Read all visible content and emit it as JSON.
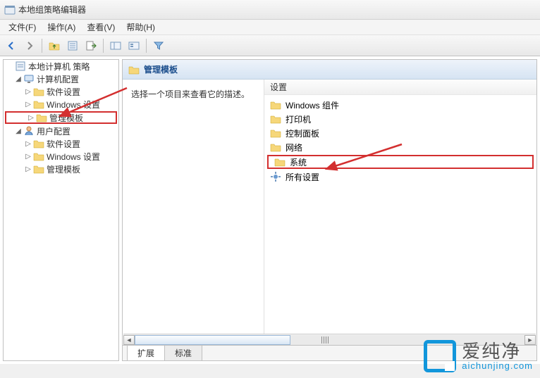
{
  "window": {
    "title": "本地组策略编辑器"
  },
  "menu": {
    "file": "文件(F)",
    "action": "操作(A)",
    "view": "查看(V)",
    "help": "帮助(H)"
  },
  "tree": {
    "root": "本地计算机 策略",
    "computer_config": "计算机配置",
    "cc_software": "软件设置",
    "cc_windows": "Windows 设置",
    "cc_admin": "管理模板",
    "user_config": "用户配置",
    "uc_software": "软件设置",
    "uc_windows": "Windows 设置",
    "uc_admin": "管理模板"
  },
  "right": {
    "header": "管理模板",
    "description_prompt": "选择一个项目来查看它的描述。",
    "column_header": "设置",
    "items": {
      "windows_components": "Windows 组件",
      "printers": "打印机",
      "control_panel": "控制面板",
      "network": "网络",
      "system": "系统",
      "all_settings": "所有设置"
    }
  },
  "tabs": {
    "extended": "扩展",
    "standard": "标准"
  },
  "watermark": {
    "brand": "爱纯净",
    "url": "aichunjing.com"
  }
}
